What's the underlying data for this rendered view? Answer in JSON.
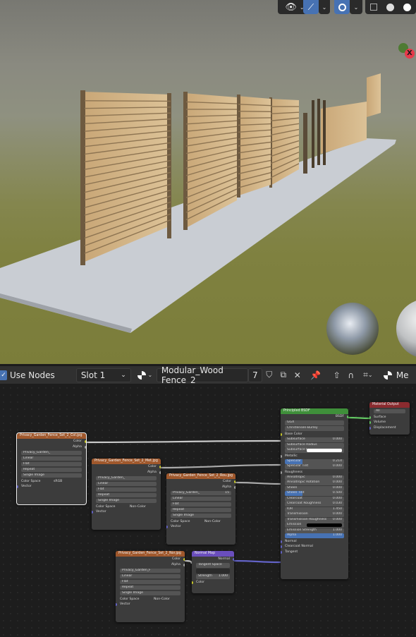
{
  "viewport": {
    "gizmo_x_label": "X",
    "icons": [
      "eye-icon",
      "overlay-icon",
      "shading-wire-icon",
      "solid-shade-icon",
      "material-shade-icon"
    ]
  },
  "toolbar": {
    "use_nodes_label": "Use Nodes",
    "slot_label": "Slot 1",
    "material_name": "Modular_Wood Fence_2",
    "user_count": "7",
    "trailing_label": "Me"
  },
  "nodes": {
    "tex1": {
      "title": "Privacy_Garden_Fence_Set_2_Col.jpg",
      "out_color": "Color",
      "out_alpha": "Alpha",
      "image_name": "Privacy_Garden_",
      "interp": "Linear",
      "proj": "Flat",
      "ext": "Repeat",
      "src": "Single Image",
      "cs_label": "Color Space",
      "cs_value": "sRGB",
      "vec": "Vector"
    },
    "tex2": {
      "title": "Privacy_Garden_Fence_Set_2_Met.jpg",
      "out_color": "Color",
      "out_alpha": "Alpha",
      "image_name": "Privacy_Garden_",
      "interp": "Linear",
      "proj": "Flat",
      "ext": "Repeat",
      "src": "Single Image",
      "cs_label": "Color Space",
      "cs_value": "Non-Color",
      "vec": "Vector"
    },
    "tex3": {
      "title": "Privacy_Garden_Fence_Set_2_Rou.jpg",
      "out_color": "Color",
      "out_alpha": "Alpha",
      "image_name": "Privacy_Garden_",
      "user_count": "15",
      "interp": "Linear",
      "proj": "Flat",
      "ext": "Repeat",
      "src": "Single Image",
      "cs_label": "Color Space",
      "cs_value": "Non-Color",
      "vec": "Vector"
    },
    "tex4": {
      "title": "Privacy_Garden_Fence_Set_2_Nor.jpg",
      "out_color": "Color",
      "out_alpha": "Alpha",
      "image_name": "Privacy_Garden_F",
      "interp": "Linear",
      "proj": "Flat",
      "ext": "Repeat",
      "src": "Single Image",
      "cs_label": "Color Space",
      "cs_value": "Non-Color",
      "vec": "Vector"
    },
    "normal": {
      "title": "Normal Map",
      "out": "Normal",
      "space": "Tangent Space",
      "strength_label": "Strength",
      "strength_value": "1.000",
      "in_color": "Color"
    },
    "bsdf": {
      "title": "Principled BSDF",
      "out": "BSDF",
      "dist": "GGX",
      "sss_method": "Christensen-Burley",
      "rows": [
        {
          "label": "Base Color",
          "value": ""
        },
        {
          "label": "Subsurface",
          "value": "0.000"
        },
        {
          "label": "Subsurface Radius",
          "value": ""
        },
        {
          "label": "Subsurface C...",
          "value": ""
        },
        {
          "label": "Metallic",
          "value": ""
        },
        {
          "label": "Specular",
          "value": "0.214"
        },
        {
          "label": "Specular Tint",
          "value": "0.000"
        },
        {
          "label": "Roughness",
          "value": ""
        },
        {
          "label": "Anisotropic",
          "value": "0.000"
        },
        {
          "label": "Anisotropic Rotation",
          "value": "0.000"
        },
        {
          "label": "Sheen",
          "value": "0.000"
        },
        {
          "label": "Sheen Tint",
          "value": "0.500"
        },
        {
          "label": "Clearcoat",
          "value": "0.000"
        },
        {
          "label": "Clearcoat Roughness",
          "value": "0.030"
        },
        {
          "label": "IOR",
          "value": "1.450"
        },
        {
          "label": "Transmission",
          "value": "0.000"
        },
        {
          "label": "Transmission Roughness",
          "value": "0.000"
        },
        {
          "label": "Emission",
          "value": ""
        },
        {
          "label": "Emission Strength",
          "value": "1.000"
        },
        {
          "label": "Alpha",
          "value": "1.000"
        },
        {
          "label": "Normal",
          "value": ""
        },
        {
          "label": "Clearcoat Normal",
          "value": ""
        },
        {
          "label": "Tangent",
          "value": ""
        }
      ]
    },
    "output": {
      "title": "Material Output",
      "target": "All",
      "surface": "Surface",
      "volume": "Volume",
      "displacement": "Displacement"
    }
  }
}
